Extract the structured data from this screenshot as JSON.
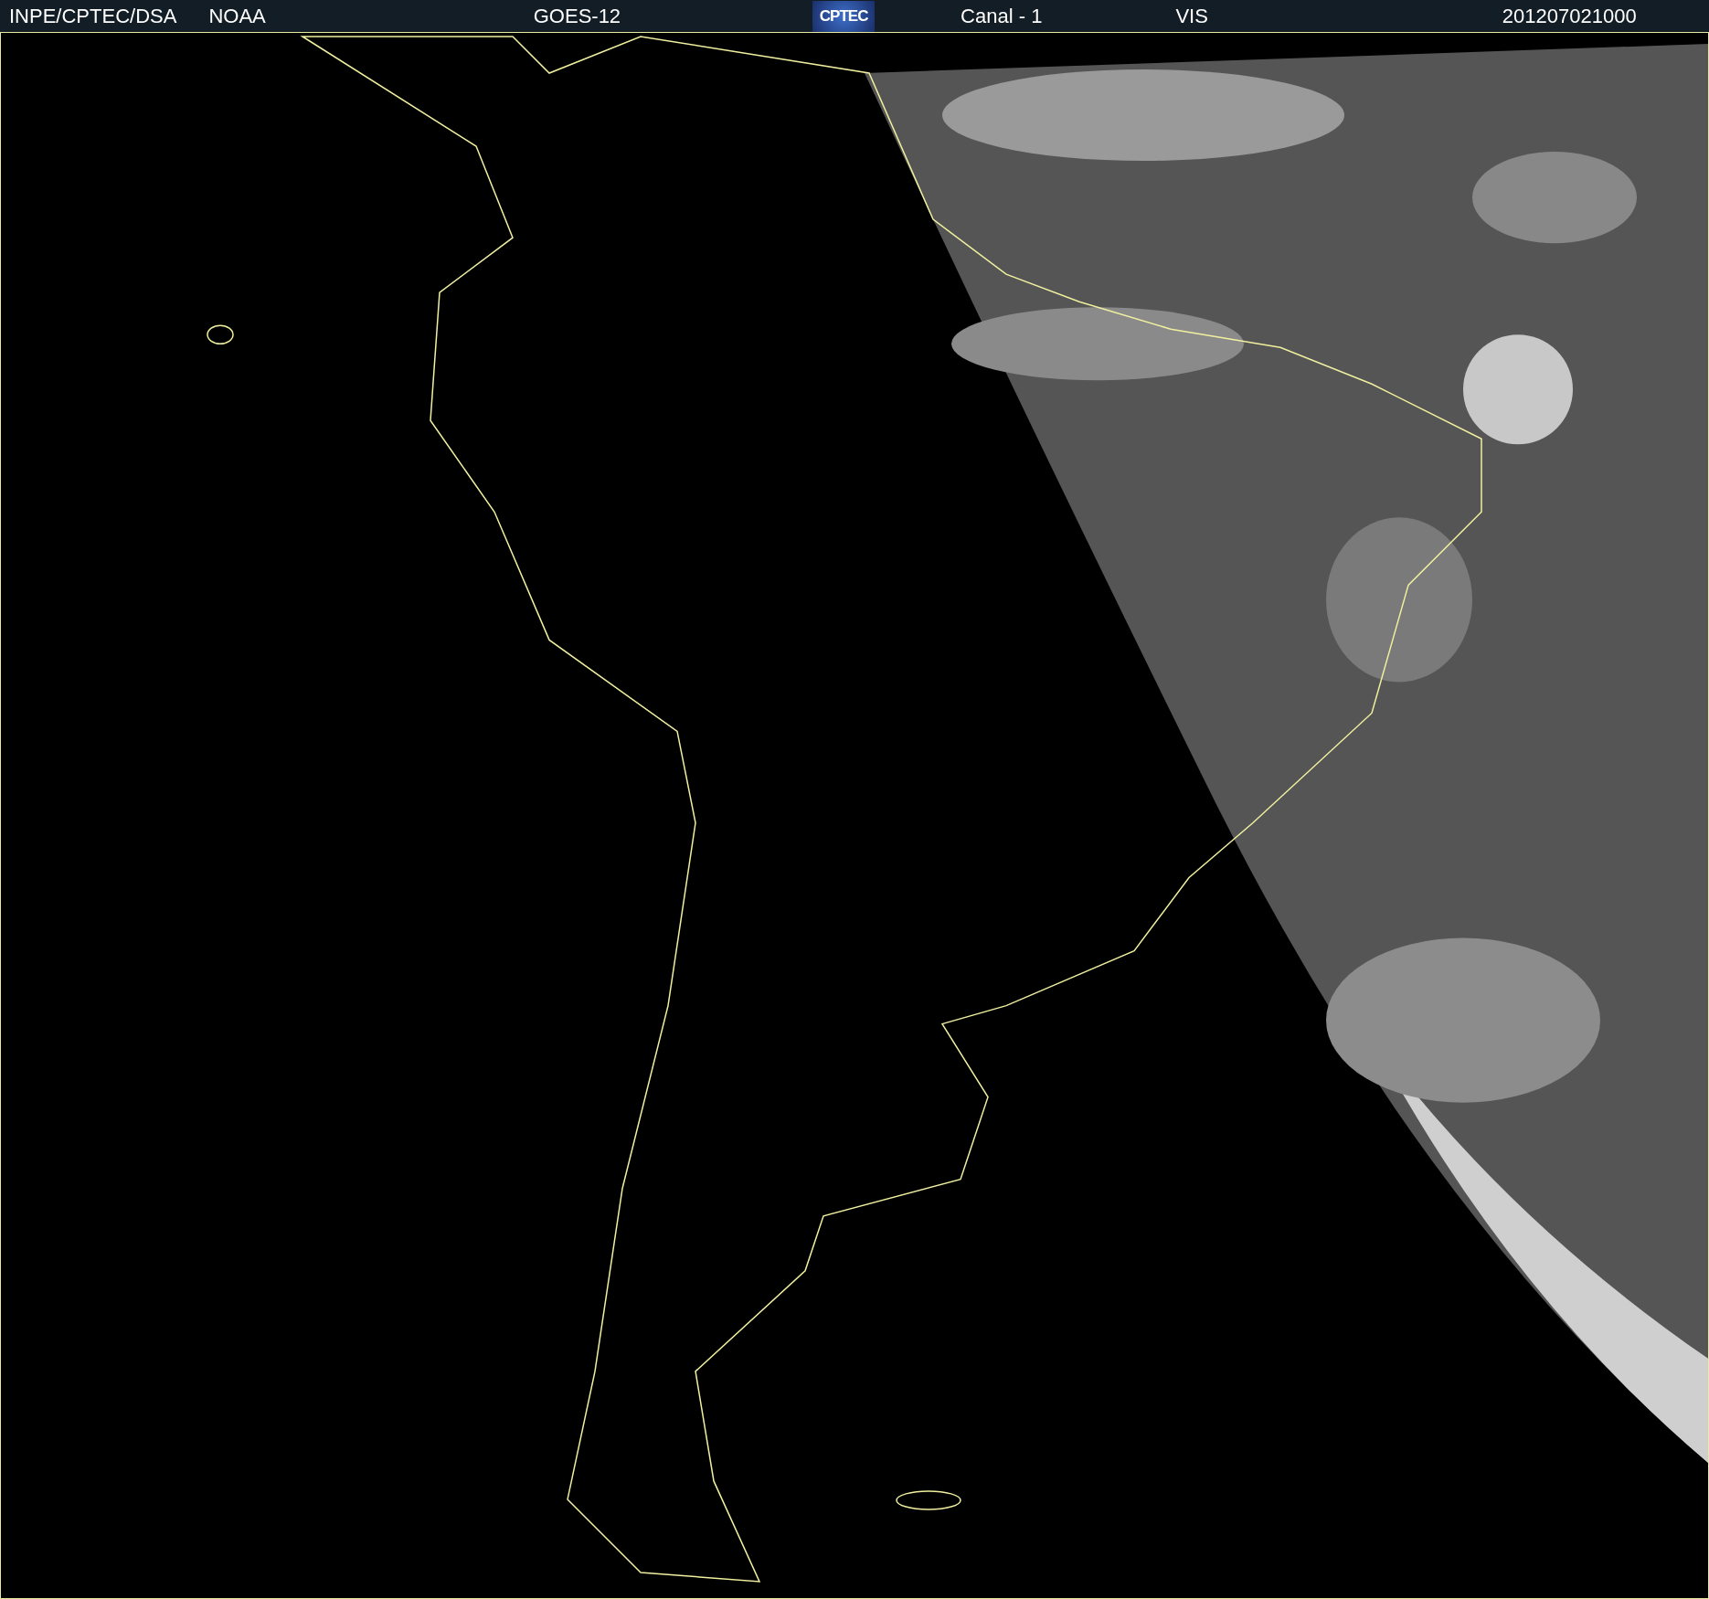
{
  "header": {
    "items": [
      {
        "kind": "text",
        "text": "INPE/CPTEC/DSA"
      },
      {
        "kind": "text",
        "text": "NOAA"
      },
      {
        "kind": "text",
        "text": "GOES-12"
      },
      {
        "kind": "logo",
        "text": "CPTEC"
      },
      {
        "kind": "text",
        "text": "Canal - 1"
      },
      {
        "kind": "text",
        "text": "VIS"
      },
      {
        "kind": "text",
        "text": "201207021000"
      }
    ]
  }
}
